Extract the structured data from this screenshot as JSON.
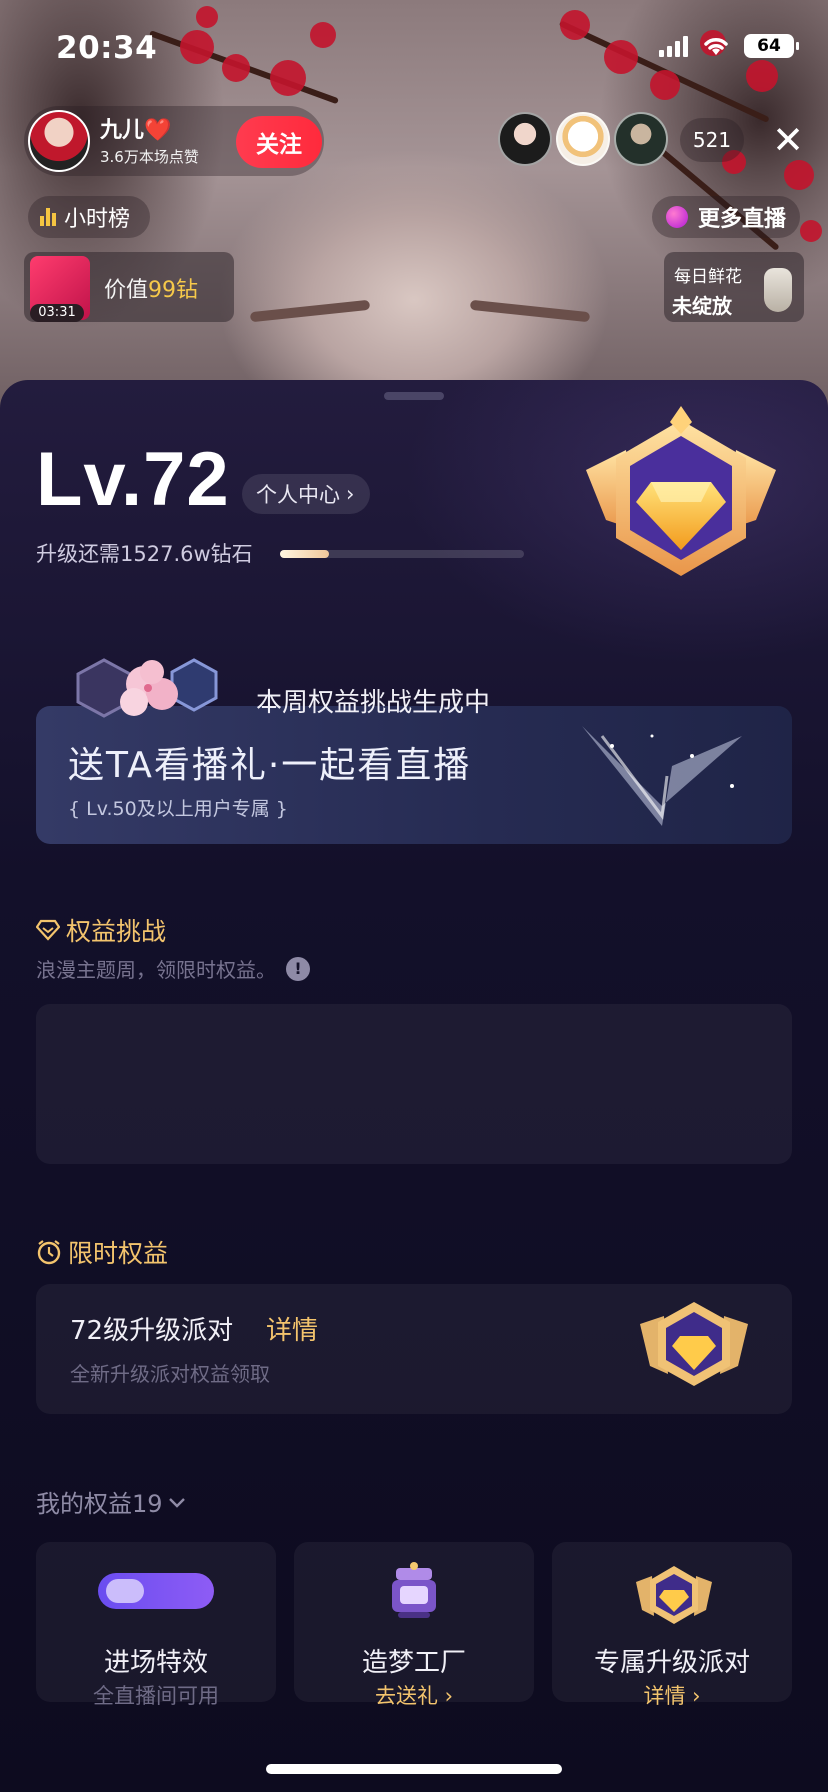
{
  "status_bar": {
    "time": "20:34",
    "battery": "64"
  },
  "host": {
    "name": "九儿❤️",
    "likes": "3.6万本场点赞",
    "follow_label": "关注"
  },
  "viewers": {
    "count": "521"
  },
  "rank": {
    "label": "小时榜"
  },
  "more_live": {
    "label": "更多直播"
  },
  "gift": {
    "timer": "03:31",
    "value_prefix": "价值",
    "value_amount": "99钻"
  },
  "daily_flower": {
    "title": "每日鲜花",
    "status": "未绽放"
  },
  "level": {
    "label": "Lv.72",
    "center_label": "个人中心",
    "upgrade_text": "升级还需1527.6w钻石",
    "progress": 0.2
  },
  "banner": {
    "title": "送TA看播礼·一起看直播",
    "subtitle": "Lv.50及以上用户专属"
  },
  "challenge": {
    "title": "权益挑战",
    "subtitle": "浪漫主题周，领限时权益。",
    "info_icon": "!",
    "card_text": "本周权益挑战生成中"
  },
  "limited": {
    "title": "限时权益",
    "party_title": "72级升级派对",
    "party_detail": "详情",
    "party_sub": "全新升级派对权益领取"
  },
  "my_rights": {
    "label": "我的权益19",
    "tiles": [
      {
        "label": "进场特效",
        "sub": "全直播间可用"
      },
      {
        "label": "造梦工厂",
        "sub": "去送礼"
      },
      {
        "label": "专属升级派对",
        "sub": "详情"
      }
    ]
  },
  "colors": {
    "accent_gold": "#f3c46d",
    "follow_red": "#ff3b4f",
    "sheet_bg": "#13102a"
  }
}
